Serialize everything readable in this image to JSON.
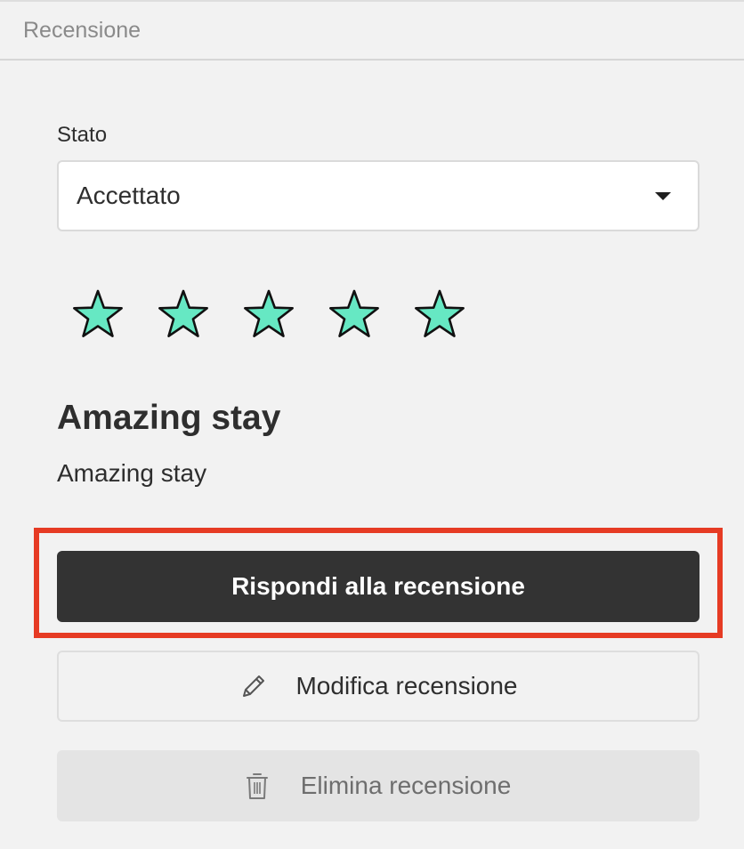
{
  "panel": {
    "title": "Recensione"
  },
  "status": {
    "label": "Stato",
    "selected": "Accettato",
    "caret_icon": "caret-down-icon"
  },
  "rating": {
    "value": 5,
    "max": 5,
    "icon": "star-icon",
    "fill_color": "#66e8c3",
    "stroke_color": "#111111"
  },
  "review": {
    "title": "Amazing stay",
    "body": "Amazing stay"
  },
  "actions": {
    "reply_label": "Rispondi alla recensione",
    "edit_label": "Modifica recensione",
    "edit_icon": "pencil-icon",
    "delete_label": "Elimina recensione",
    "delete_icon": "trash-icon"
  },
  "colors": {
    "highlight": "#e63b24",
    "primary_button": "#333333",
    "background": "#f2f2f2"
  }
}
